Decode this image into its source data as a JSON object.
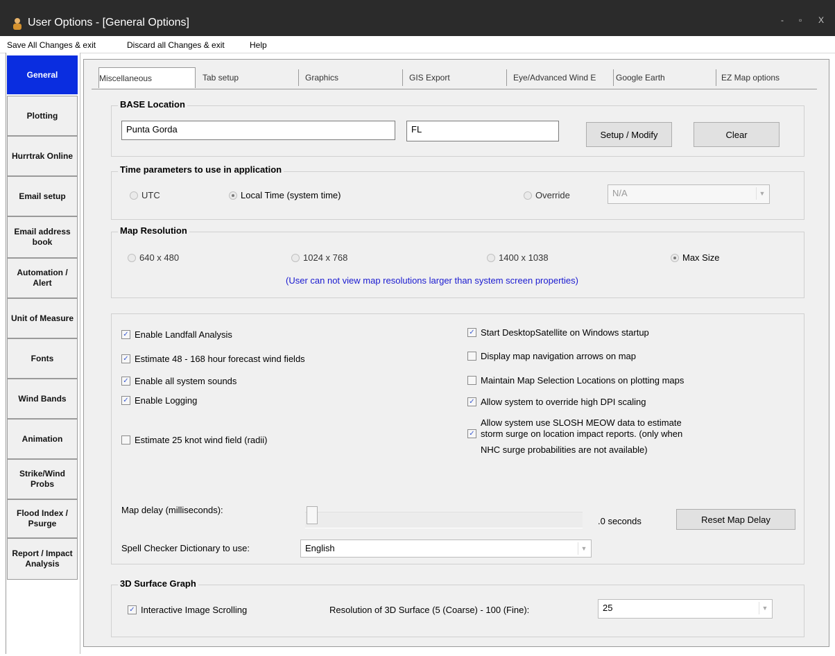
{
  "window": {
    "title": "User Options - [General Options]",
    "controls": [
      "-",
      "▫",
      "X"
    ]
  },
  "menu": [
    {
      "label": "Save All Changes & exit"
    },
    {
      "label": "Discard all Changes & exit"
    },
    {
      "label": "Help"
    }
  ],
  "sidebar": {
    "items": [
      {
        "label": "General",
        "active": true
      },
      {
        "label": "Plotting"
      },
      {
        "label": "Hurrtrak Online"
      },
      {
        "label": "Email setup"
      },
      {
        "label": "Email address book"
      },
      {
        "label": "Automation / Alert"
      },
      {
        "label": "Unit of Measure"
      },
      {
        "label": "Fonts"
      },
      {
        "label": "Wind Bands"
      },
      {
        "label": "Animation"
      },
      {
        "label": "Strike/Wind Probs"
      },
      {
        "label": "Flood Index / Psurge"
      },
      {
        "label": "Report / Impact Analysis"
      }
    ]
  },
  "tabs": [
    {
      "label": "Miscellaneous",
      "active": true
    },
    {
      "label": "Tab setup"
    },
    {
      "label": "Graphics"
    },
    {
      "label": "GIS Export"
    },
    {
      "label": "Eye/Advanced Wind E"
    },
    {
      "label": "Google Earth"
    },
    {
      "label": "EZ Map options"
    }
  ],
  "base_location": {
    "title": "BASE Location",
    "city": "Punta Gorda",
    "state": "FL",
    "setup_button": "Setup / Modify",
    "clear_button": "Clear"
  },
  "time_params": {
    "title": "Time parameters to use in application",
    "utc_label": "UTC",
    "local_label": "Local Time (system time)",
    "override_label": "Override",
    "override_value": "N/A",
    "selected": "local"
  },
  "map_resolution": {
    "title": "Map Resolution",
    "options": [
      "640 x 480",
      "1024 x 768",
      "1400 x 1038",
      "Max Size"
    ],
    "selected": "Max Size",
    "note": "(User can not view map resolutions larger than system screen properties)",
    "note_color": "#1a1ad0"
  },
  "options": {
    "left": [
      {
        "label": "Enable Landfall Analysis",
        "checked": true
      },
      {
        "label": "Estimate 48 - 168 hour forecast wind fields",
        "checked": true
      },
      {
        "label": "Enable all system sounds",
        "checked": true
      },
      {
        "label": "Enable Logging",
        "checked": true
      },
      {
        "label": "Estimate 25 knot wind field (radii)",
        "checked": false
      }
    ],
    "right": [
      {
        "label": "Start DesktopSatellite on Windows startup",
        "checked": true
      },
      {
        "label": "Display map navigation arrows on map",
        "checked": false
      },
      {
        "label": "Maintain Map Selection Locations on plotting maps",
        "checked": false
      },
      {
        "label": "Allow system to override high DPI scaling",
        "checked": true
      }
    ],
    "slosh": {
      "line1": "Allow system use SLOSH MEOW data to estimate",
      "line2": "storm surge on location impact reports. (only when",
      "line3": "NHC surge probabilities are not available)",
      "checked": true
    }
  },
  "map_delay": {
    "label": "Map delay (milliseconds):",
    "value_text": ".0 seconds",
    "slider_fraction": 0,
    "reset_button": "Reset Map Delay"
  },
  "spell": {
    "label": "Spell Checker Dictionary to use:",
    "value": "English"
  },
  "surface": {
    "title": "3D Surface Graph",
    "scroll_label": "Interactive Image Scrolling",
    "scroll_checked": true,
    "res_label": "Resolution of 3D Surface (5 (Coarse) - 100 (Fine):",
    "res_value": "25"
  },
  "colors": {
    "active_nav": "#0a2de0",
    "titlebar": "#2b2b2b"
  }
}
